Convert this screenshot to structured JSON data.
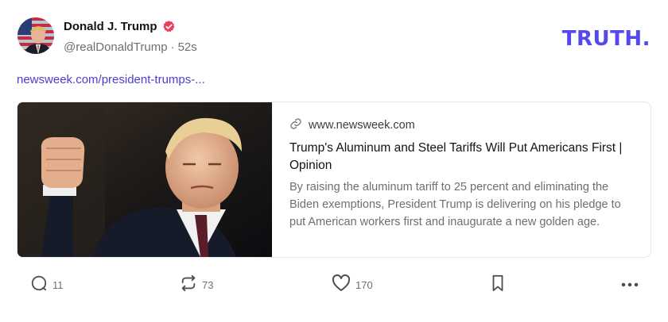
{
  "header": {
    "display_name": "Donald J. Trump",
    "handle": "@realDonaldTrump",
    "separator": "·",
    "timestamp": "52s",
    "brand": "TRUTH."
  },
  "post": {
    "link_text": "newsweek.com/president-trumps-..."
  },
  "card": {
    "domain": "www.newsweek.com",
    "title": "Trump's Aluminum and Steel Tariffs Will Put Americans First | Opinion",
    "description": "By raising the aluminum tariff to 25 percent and eliminating the Biden exemptions, President Trump is delivering on his pledge to put American workers first and inaugurate a new golden age."
  },
  "actions": {
    "reply_count": "11",
    "retruth_count": "73",
    "like_count": "170"
  },
  "colors": {
    "brand": "#5448ee",
    "link": "#4b3dd3",
    "verified": "#e8405a"
  },
  "icons": {
    "verified": "verified-badge-icon",
    "link": "link-icon",
    "reply": "reply-icon",
    "retruth": "retruth-icon",
    "like": "heart-icon",
    "save": "bookmark-icon",
    "more": "more-icon"
  }
}
